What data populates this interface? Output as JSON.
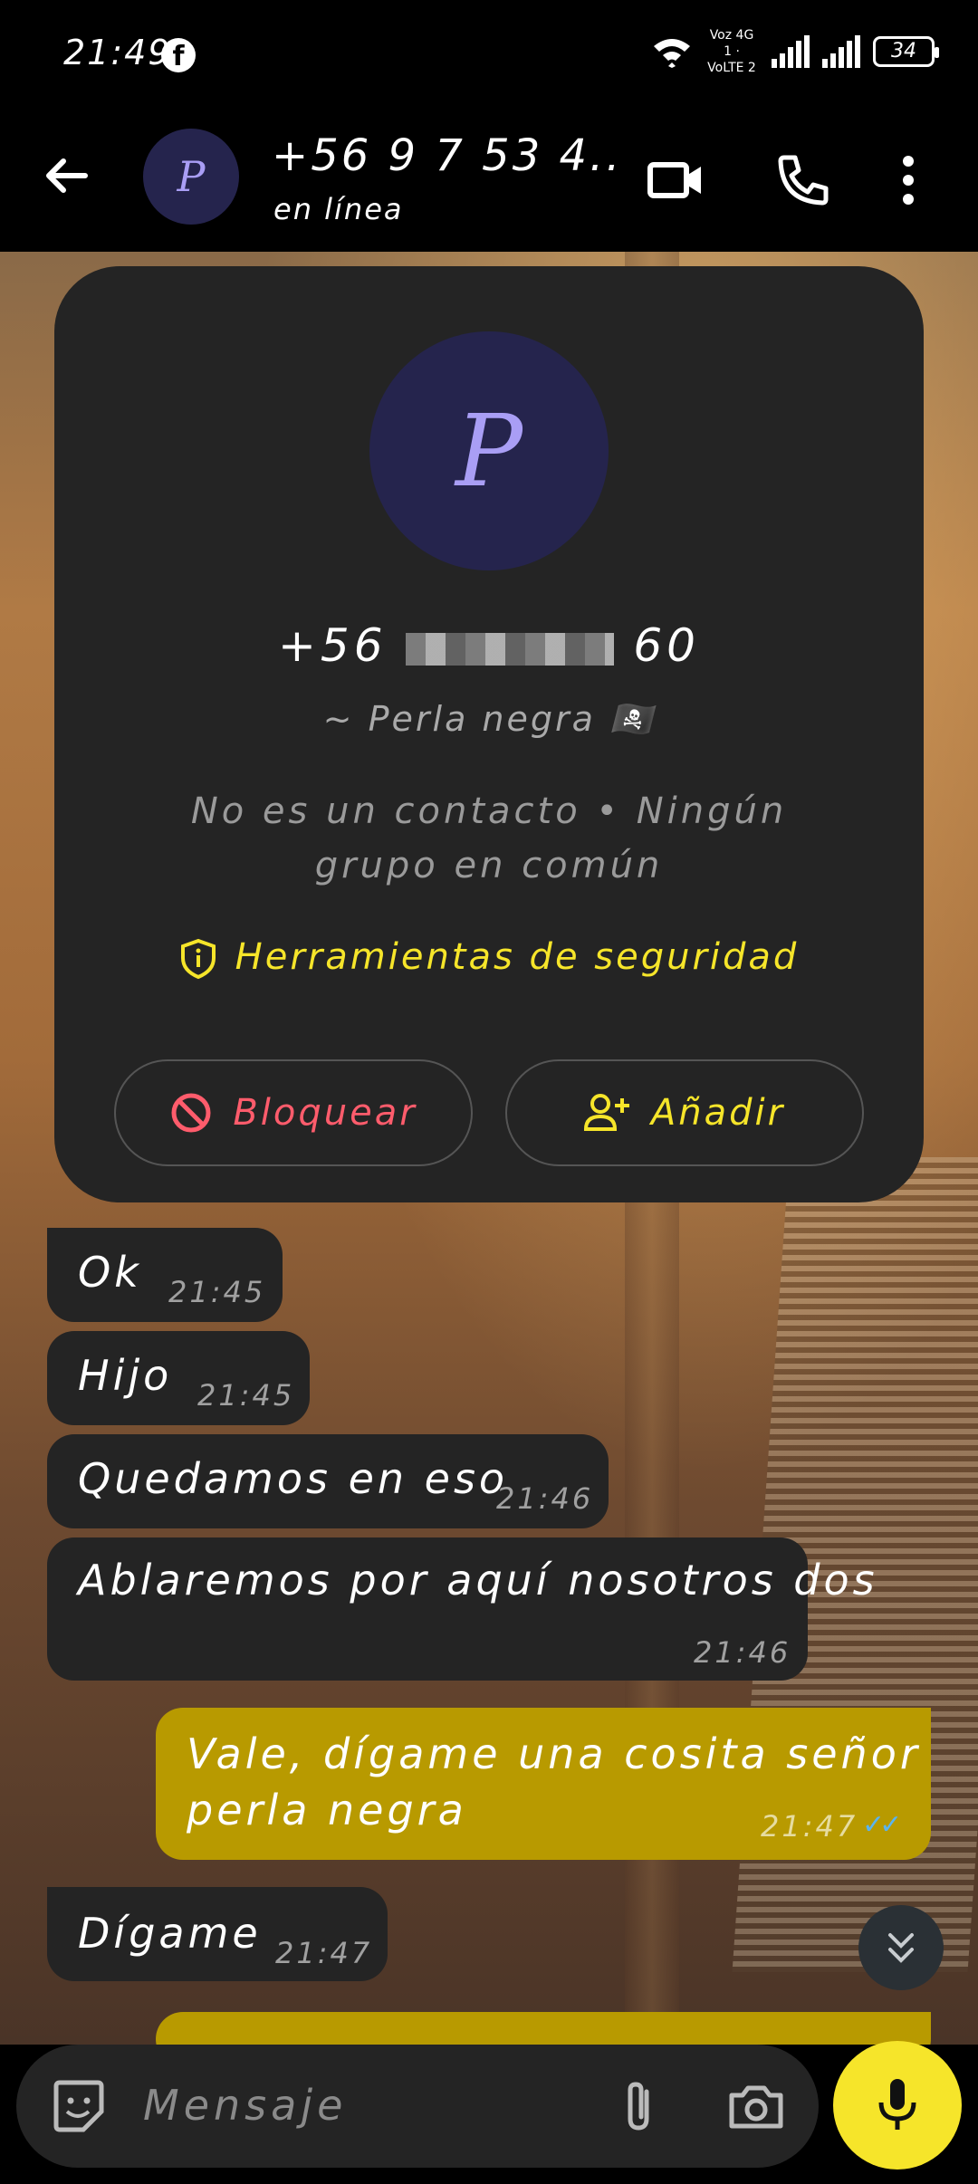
{
  "status_bar": {
    "time": "21:49",
    "battery": "34",
    "network_label": "Voz 4G 1 · VoLTE 2"
  },
  "header": {
    "title": "+56 9 7 53 4...",
    "subtitle": "en línea",
    "avatar_letter": "P"
  },
  "profile_card": {
    "avatar_letter": "P",
    "phone_prefix": "+56",
    "phone_suffix": "60",
    "name": "~ Perla negra 🏴‍☠️",
    "info": "No es un contacto • Ningún grupo en común",
    "security_label": "Herramientas de seguridad",
    "block_label": "Bloquear",
    "add_label": "Añadir"
  },
  "messages": [
    {
      "direction": "in",
      "text": "Ok",
      "time": "21:45"
    },
    {
      "direction": "in",
      "text": "Hijo",
      "time": "21:45"
    },
    {
      "direction": "in",
      "text": "Quedamos en eso",
      "time": "21:46"
    },
    {
      "direction": "in",
      "text": "Ablaremos por aquí nosotros dos",
      "time": "21:46"
    },
    {
      "direction": "out",
      "text_line1": "Vale, dígame una cosita señor",
      "text_line2": "perla negra",
      "time": "21:47",
      "status": "read"
    },
    {
      "direction": "in",
      "text": "Dígame",
      "time": "21:47"
    }
  ],
  "input": {
    "placeholder": "Mensaje"
  },
  "colors": {
    "accent": "#f6e52a",
    "outgoing_bubble": "#b89a00",
    "incoming_bubble": "#242424",
    "danger": "#ff5c6c",
    "read_ticks": "#5ab4f0"
  },
  "icons": [
    "back-arrow-icon",
    "video-call-icon",
    "phone-icon",
    "more-vert-icon",
    "shield-icon",
    "block-icon",
    "add-person-icon",
    "double-chevron-down-icon",
    "sticker-icon",
    "attach-icon",
    "camera-icon",
    "mic-icon"
  ]
}
